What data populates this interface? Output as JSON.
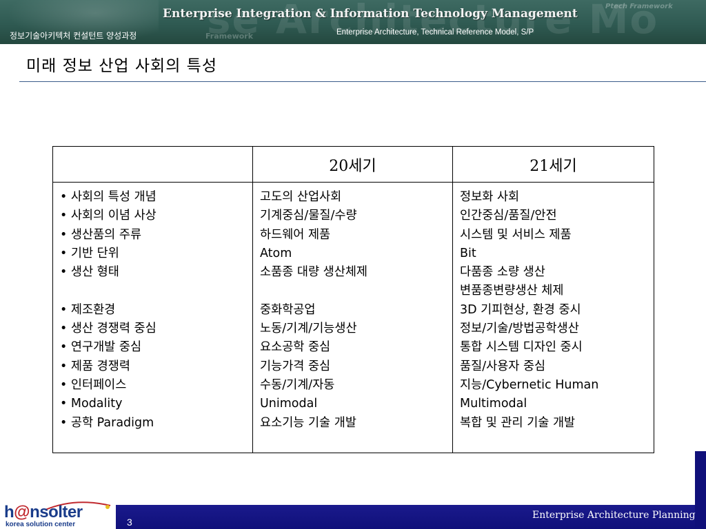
{
  "header": {
    "banner_title": "Enterprise Integration & Information Technology Management",
    "course_name": "정보기술아키텍처 컨설턴트 양성과정",
    "topics": "Enterprise Architecture, Technical Reference Model, S/P",
    "watermark_large": "se Architecture Mo",
    "watermark_small_1": "Framework",
    "watermark_small_2": "Ptech Framework"
  },
  "page": {
    "title": "미래 정보 산업 사회의 특성"
  },
  "table": {
    "headers": [
      "",
      "20세기",
      "21세기"
    ],
    "categories": [
      "• 사회의 특성 개념",
      "• 사회의 이념 사상",
      "• 생산품의 주류",
      "• 기반 단위",
      "• 생산 형태",
      "",
      "• 제조환경",
      "• 생산 경쟁력 중심",
      "• 연구개발 중심",
      "• 제품 경쟁력",
      "• 인터페이스",
      "• Modality",
      "• 공학 Paradigm"
    ],
    "century_20": [
      "고도의 산업사회",
      "기계중심/물질/수량",
      "하드웨어 제품",
      "Atom",
      "소품종 대량 생산체제",
      "",
      "중화학공업",
      "노동/기계/기능생산",
      "요소공학 중심",
      "기능가격 중심",
      "수동/기계/자동",
      "Unimodal",
      "요소기능 기술 개발"
    ],
    "century_21": [
      "정보화 사회",
      "인간중심/품질/안전",
      "시스템 및 서비스 제품",
      "Bit",
      "다품종 소량 생산",
      "변품종변량생산 체제",
      "3D 기피현상, 환경 중시",
      "정보/기술/방법공학생산",
      "통합 시스템 디자인 중시",
      "품질/사용자 중심",
      "지능/Cybernetic Human",
      "Multimodal",
      "복합 및 관리 기술 개발"
    ]
  },
  "footer": {
    "page_number": "3",
    "text": "Enterprise Architecture Planning",
    "logo_brand_pre": "h",
    "logo_brand_at": "@",
    "logo_brand_post": "nsolter",
    "logo_tag": "korea solution center"
  },
  "colors": {
    "banner": "#2f5a52",
    "footer_bar": "#10107a",
    "title_rule": "#3a5a8a",
    "logo_blue": "#1a3c8a",
    "logo_red": "#c0282e"
  }
}
